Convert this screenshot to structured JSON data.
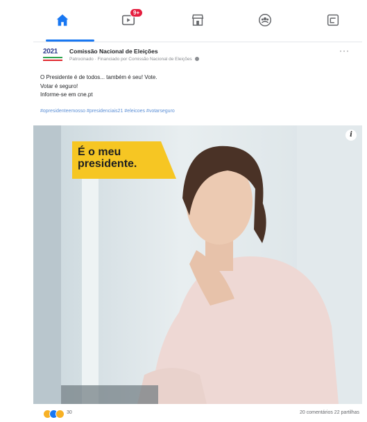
{
  "nav": {
    "tabs": [
      {
        "name": "home",
        "icon": "home-icon",
        "active": true
      },
      {
        "name": "watch",
        "icon": "video-icon",
        "badge": "9+"
      },
      {
        "name": "marketplace",
        "icon": "store-icon"
      },
      {
        "name": "groups",
        "icon": "groups-icon"
      },
      {
        "name": "gaming",
        "icon": "gaming-icon"
      }
    ],
    "accent": "#1877f2"
  },
  "post": {
    "logo_text": "2021",
    "page_name": "Comissão Nacional de Eleições",
    "sponsored_line": "Patrocinado · Financiado por Comissão Nacional de Eleições",
    "text_lines": [
      "O Presidente é de todos... também é seu! Vote.",
      "Votar é seguro!",
      "Informe-se em cne.pt"
    ],
    "hashtags": "#opresidenteemosso #presidenciais21 #eleicoes #votarseguro",
    "ad_banner_lines": [
      "É o meu",
      "presidente."
    ],
    "info_label": "i",
    "reactions_count": "30",
    "stats": "20 comentários  22 partilhas",
    "banner_color": "#f6c623"
  }
}
